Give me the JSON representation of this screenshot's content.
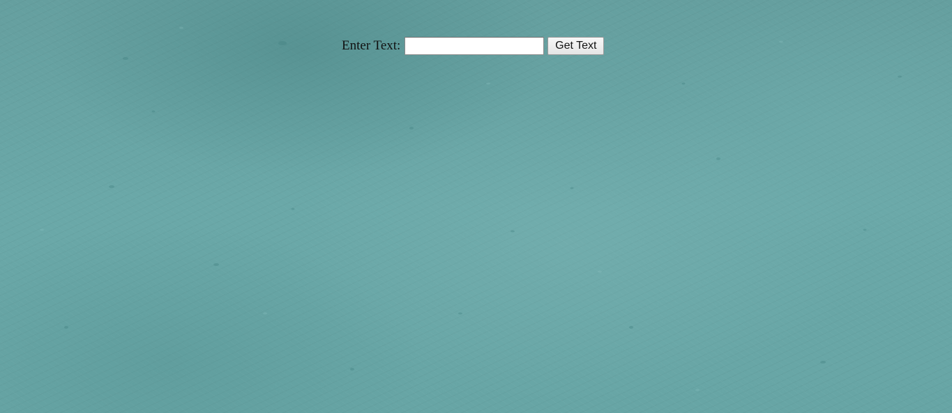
{
  "page": {
    "background_color": "#6aa8a8"
  },
  "form": {
    "label": "Enter Text:",
    "input_value": "",
    "input_placeholder": "",
    "button_label": "Get Text"
  }
}
